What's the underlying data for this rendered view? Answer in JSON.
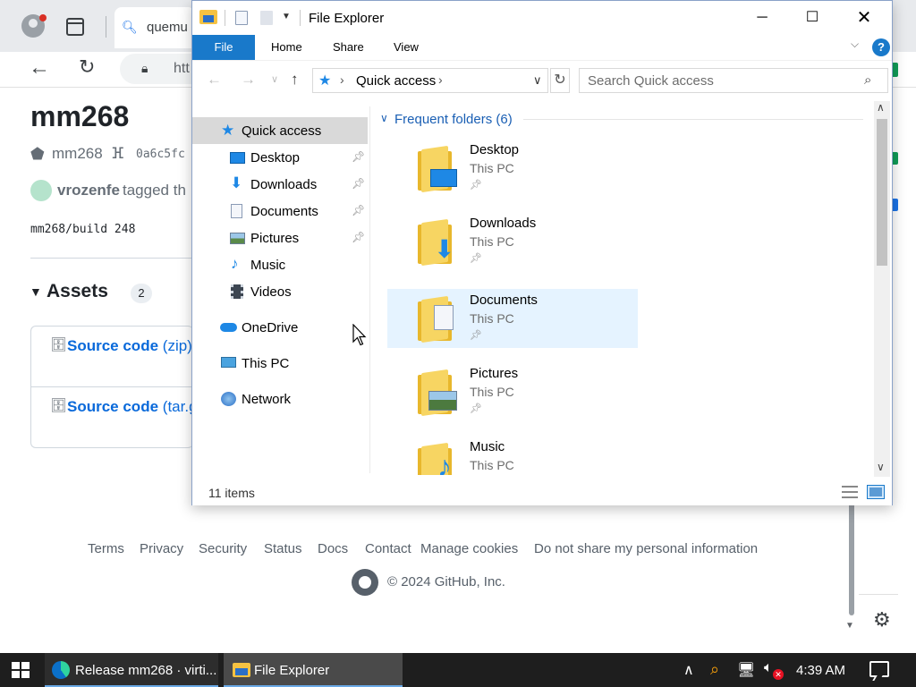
{
  "browser": {
    "tab": {
      "title": "quemu"
    },
    "address": {
      "url": "htt"
    }
  },
  "github": {
    "release_title": "mm268",
    "tag": "mm268",
    "commit": "0a6c5fc",
    "author": "vrozenfe",
    "action": "tagged th",
    "body": "mm268/build 248",
    "assets_label": "Assets",
    "assets_count": "2",
    "assets": [
      {
        "label": "Source code",
        "format": "(zip)"
      },
      {
        "label": "Source code",
        "format": "(tar.g"
      }
    ],
    "footer_links": [
      "Terms",
      "Privacy",
      "Security",
      "Status",
      "Docs",
      "Contact",
      "Manage cookies",
      "Do not share my personal information"
    ],
    "copyright": "© 2024 GitHub, Inc."
  },
  "explorer": {
    "title": "File Explorer",
    "ribbon": {
      "file": "File",
      "tabs": [
        "Home",
        "Share",
        "View"
      ]
    },
    "address": {
      "location": "Quick access"
    },
    "search_placeholder": "Search Quick access",
    "nav": {
      "quick_access": "Quick access",
      "pinned": [
        "Desktop",
        "Downloads",
        "Documents",
        "Pictures"
      ],
      "unpinned": [
        "Music",
        "Videos"
      ],
      "onedrive": "OneDrive",
      "this_pc": "This PC",
      "network": "Network"
    },
    "group_title": "Frequent folders (6)",
    "folders": [
      {
        "name": "Desktop",
        "location": "This PC"
      },
      {
        "name": "Downloads",
        "location": "This PC"
      },
      {
        "name": "Documents",
        "location": "This PC"
      },
      {
        "name": "Pictures",
        "location": "This PC"
      },
      {
        "name": "Music",
        "location": "This PC"
      }
    ],
    "status": "11 items"
  },
  "taskbar": {
    "items": [
      {
        "label": "Release mm268 · virti..."
      },
      {
        "label": "File Explorer"
      }
    ],
    "clock": "4:39 AM"
  },
  "colors": {
    "accent": "#1979ca",
    "link": "#0969da",
    "folder": "#f7d562",
    "selection": "#e5f3ff"
  }
}
